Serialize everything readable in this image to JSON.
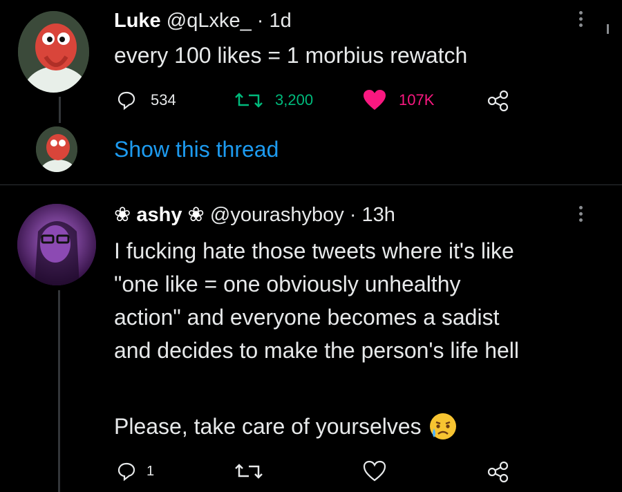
{
  "tweet1": {
    "name": "Luke",
    "handle": "@qLxke_",
    "sep": "·",
    "time": "1d",
    "text": "every 100 likes = 1 morbius rewatch",
    "replies": "534",
    "retweets": "3,200",
    "likes": "107K",
    "show_thread": "Show this thread"
  },
  "tweet2": {
    "name": "❀ ashy ❀",
    "handle": "@yourashyboy",
    "sep": "·",
    "time": "13h",
    "text_lines": [
      "I fucking hate those tweets where it's like",
      "\"one like = one obviously unhealthy",
      "action\" and everyone becomes a sadist",
      "and decides to make the person's life hell"
    ],
    "text_last": "Please, take care of yourselves",
    "emoji": "crying-face",
    "replies": "1"
  },
  "colors": {
    "link": "#1d9bf0",
    "retweet": "#00ba7c",
    "like": "#f91880",
    "muted": "#8a8d91"
  }
}
